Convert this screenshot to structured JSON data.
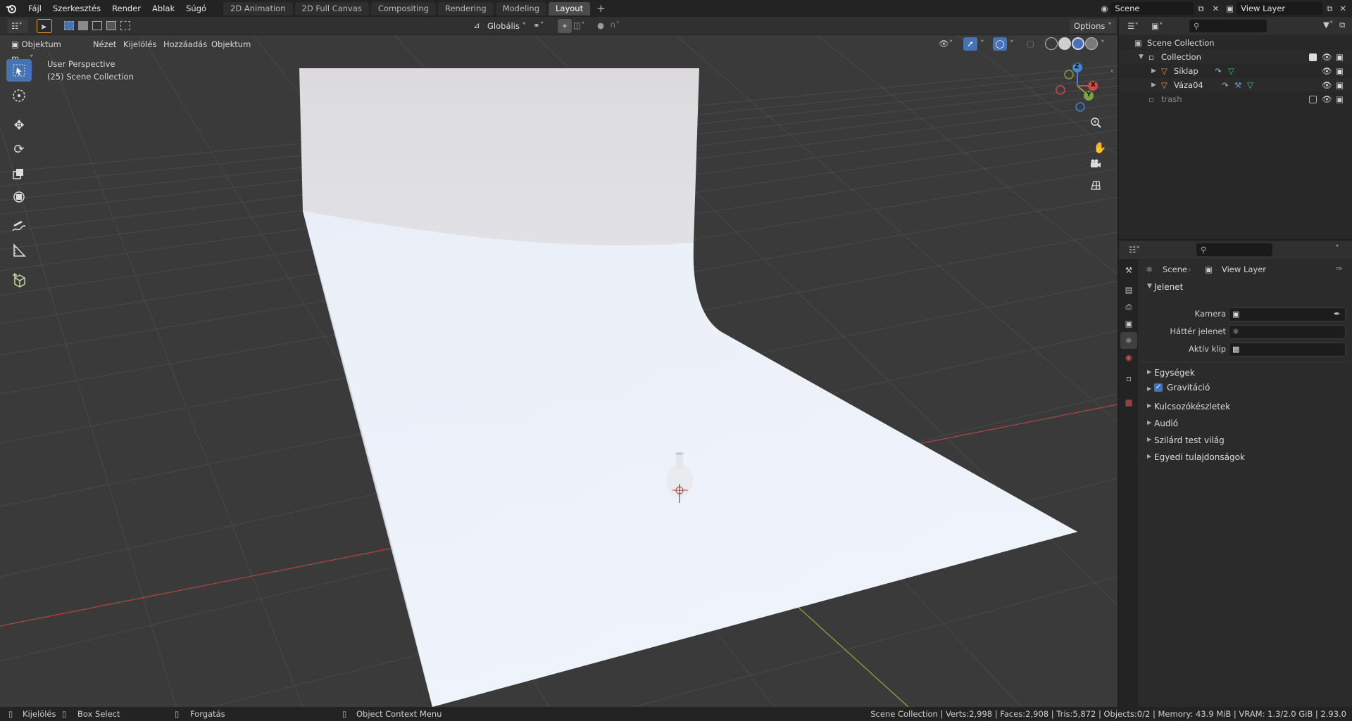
{
  "topbar": {
    "menus": [
      "Fájl",
      "Szerkesztés",
      "Render",
      "Ablak",
      "Súgó"
    ],
    "workspaces": [
      "2D Animation",
      "2D Full Canvas",
      "Compositing",
      "Rendering",
      "Modeling",
      "Layout"
    ],
    "active_workspace": "Layout",
    "scene_name": "Scene",
    "view_layer_name": "View Layer"
  },
  "toolhdr": {
    "mode": "Objektum m...",
    "orientation": "Globális",
    "options": "Options"
  },
  "viewhdr": {
    "menus": [
      "Nézet",
      "Kijelölés",
      "Hozzáadás",
      "Objektum"
    ]
  },
  "viewport": {
    "perspective_label": "User Perspective",
    "collection_label": "(25) Scene Collection"
  },
  "gizmo": {
    "x": "X",
    "y": "Y",
    "z": "Z"
  },
  "outliner": {
    "search_placeholder": "",
    "root": "Scene Collection",
    "items": [
      {
        "label": "Collection",
        "kind": "collection"
      },
      {
        "label": "Síklap",
        "kind": "mesh"
      },
      {
        "label": "Váza04",
        "kind": "mesh"
      },
      {
        "label": "trash",
        "kind": "collection-muted"
      }
    ]
  },
  "properties": {
    "breadcrumb_scene": "Scene",
    "breadcrumb_view_layer": "View Layer",
    "panel_title": "Jelenet",
    "fields": [
      {
        "label": "Kamera"
      },
      {
        "label": "Háttér jelenet"
      },
      {
        "label": "Aktív klip"
      }
    ],
    "sections": [
      "Egységek",
      "Gravitáció",
      "Kulcsozókészletek",
      "Audió",
      "Szilárd test világ",
      "Egyedi tulajdonságok"
    ],
    "gravity_checked": true
  },
  "statusbar": {
    "select": "Kijelölés",
    "box_select": "Box Select",
    "rotate": "Forgatás",
    "context_menu": "Object Context Menu",
    "stats": "Scene Collection | Verts:2,998 | Faces:2,908 | Tris:5,872 | Objects:0/2 | Memory: 43.9 MiB | VRAM: 1.3/2.0 GiB | 2.93.0"
  },
  "colors": {
    "accent": "#4772b3",
    "axis_x": "#c94a4a",
    "axis_y": "#7fa13a",
    "axis_z": "#3d86d8",
    "backdrop": "#eef2fa"
  }
}
